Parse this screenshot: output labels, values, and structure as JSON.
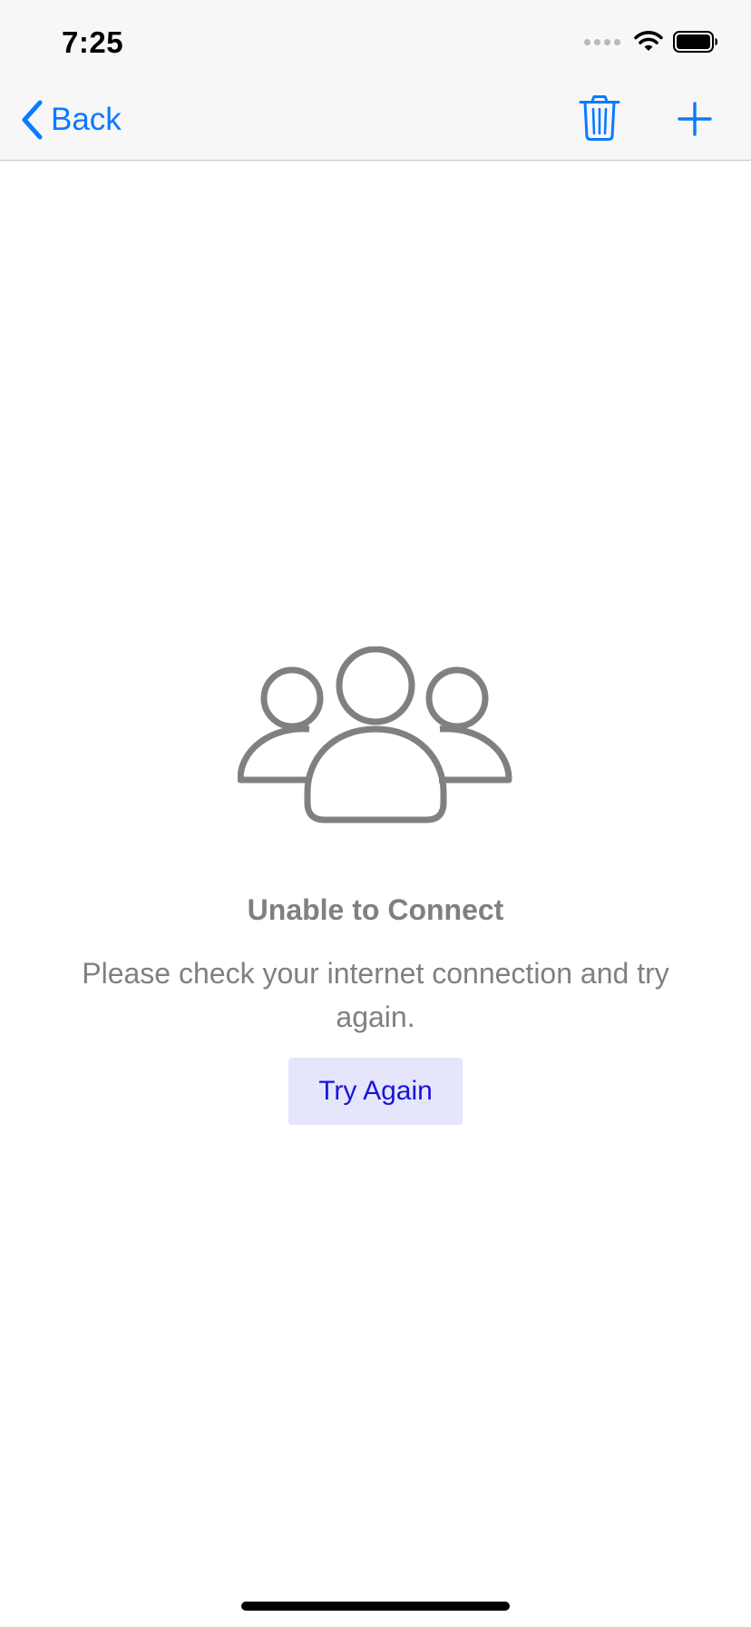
{
  "status_bar": {
    "time": "7:25",
    "icons": [
      "signal-dots-icon",
      "wifi-icon",
      "battery-icon"
    ]
  },
  "nav_bar": {
    "back_label": "Back",
    "back_icon": "chevron-left-icon",
    "trash_icon": "trash-icon",
    "add_icon": "plus-icon",
    "accent_color": "#0A7AFF"
  },
  "empty_state": {
    "icon": "group-people-icon",
    "title": "Unable to Connect",
    "message": "Please check your internet connection and try again.",
    "button_label": "Try Again",
    "text_color": "#808080",
    "button_background": "#E5E6FB",
    "button_text_color": "#1B12D9"
  }
}
